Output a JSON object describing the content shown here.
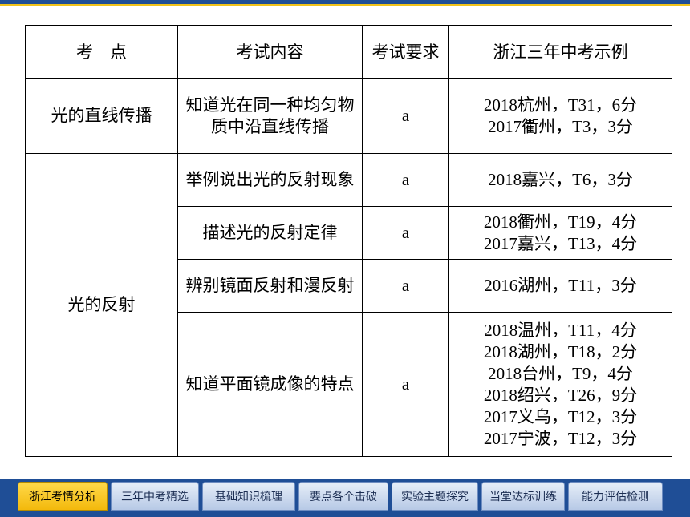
{
  "table": {
    "headers": [
      "考　点",
      "考试内容",
      "考试要求",
      "浙江三年中考示例"
    ],
    "rows": [
      {
        "point": "光的直线传播",
        "content": "知道光在同一种均匀物质中沿直线传播",
        "requirement": "a",
        "examples": [
          "2018杭州，T31，6分",
          "2017衢州，T3，3分"
        ]
      },
      {
        "point": "光的反射",
        "content": "举例说出光的反射现象",
        "requirement": "a",
        "examples": [
          "2018嘉兴，T6，3分"
        ]
      },
      {
        "content": "描述光的反射定律",
        "requirement": "a",
        "examples": [
          "2018衢州，T19，4分",
          "2017嘉兴，T13，4分"
        ]
      },
      {
        "content": "辨别镜面反射和漫反射",
        "requirement": "a",
        "examples": [
          "2016湖州，T11，3分"
        ]
      },
      {
        "content": "知道平面镜成像的特点",
        "requirement": "a",
        "examples": [
          "2018温州，T11，4分",
          "2018湖州，T18，2分",
          "2018台州，T9，4分",
          "2018绍兴，T26，9分",
          "2017义乌，T12，3分",
          "2017宁波，T12，3分"
        ]
      }
    ]
  },
  "nav": {
    "tabs": [
      "浙江考情分析",
      "三年中考精选",
      "基础知识梳理",
      "要点各个击破",
      "实验主题探究",
      "当堂达标训练",
      "能力评估检测"
    ],
    "active_index": 0
  },
  "colors": {
    "nav_bg": "#1f4e96",
    "accent": "#f0c21a",
    "tab_active": "#f3b90c"
  }
}
